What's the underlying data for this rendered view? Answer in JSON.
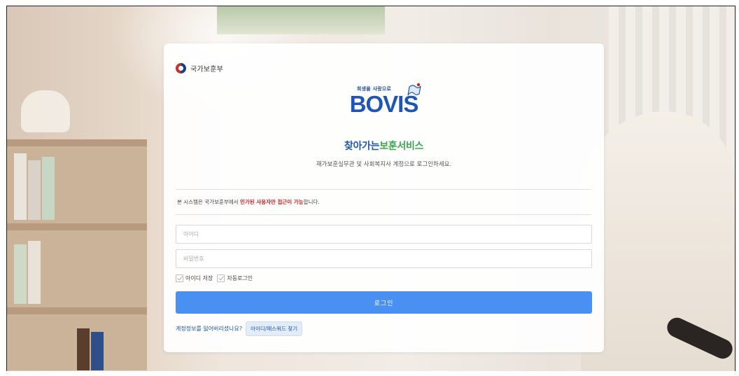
{
  "header": {
    "ministry_name": "국가보훈부"
  },
  "logo": {
    "slogan": "희생을 사랑으로",
    "mark": "BOVIS"
  },
  "service": {
    "title_part1": "찾아가는",
    "title_part2": "보훈서비스",
    "description": "재가보훈실무관 및 사회복지사 계정으로 로그인하세요."
  },
  "notice": {
    "prefix": "본 시스템은 국가보훈부에서 ",
    "highlight": "인가된 사용자만 접근이 가능",
    "suffix": "합니다."
  },
  "form": {
    "id_placeholder": "아이디",
    "password_placeholder": "비밀번호",
    "save_id_label": "아이디 저장",
    "auto_login_label": "자동로그인",
    "login_label": "로그인"
  },
  "recovery": {
    "question": "계정정보를 잃어버리셨나요?",
    "find_button": "아이디/패스워드 찾기"
  },
  "colors": {
    "primary_blue": "#1e56b8",
    "accent_green": "#3cab4f",
    "button_blue": "#4a8ff2",
    "alert_red": "#d62020"
  }
}
